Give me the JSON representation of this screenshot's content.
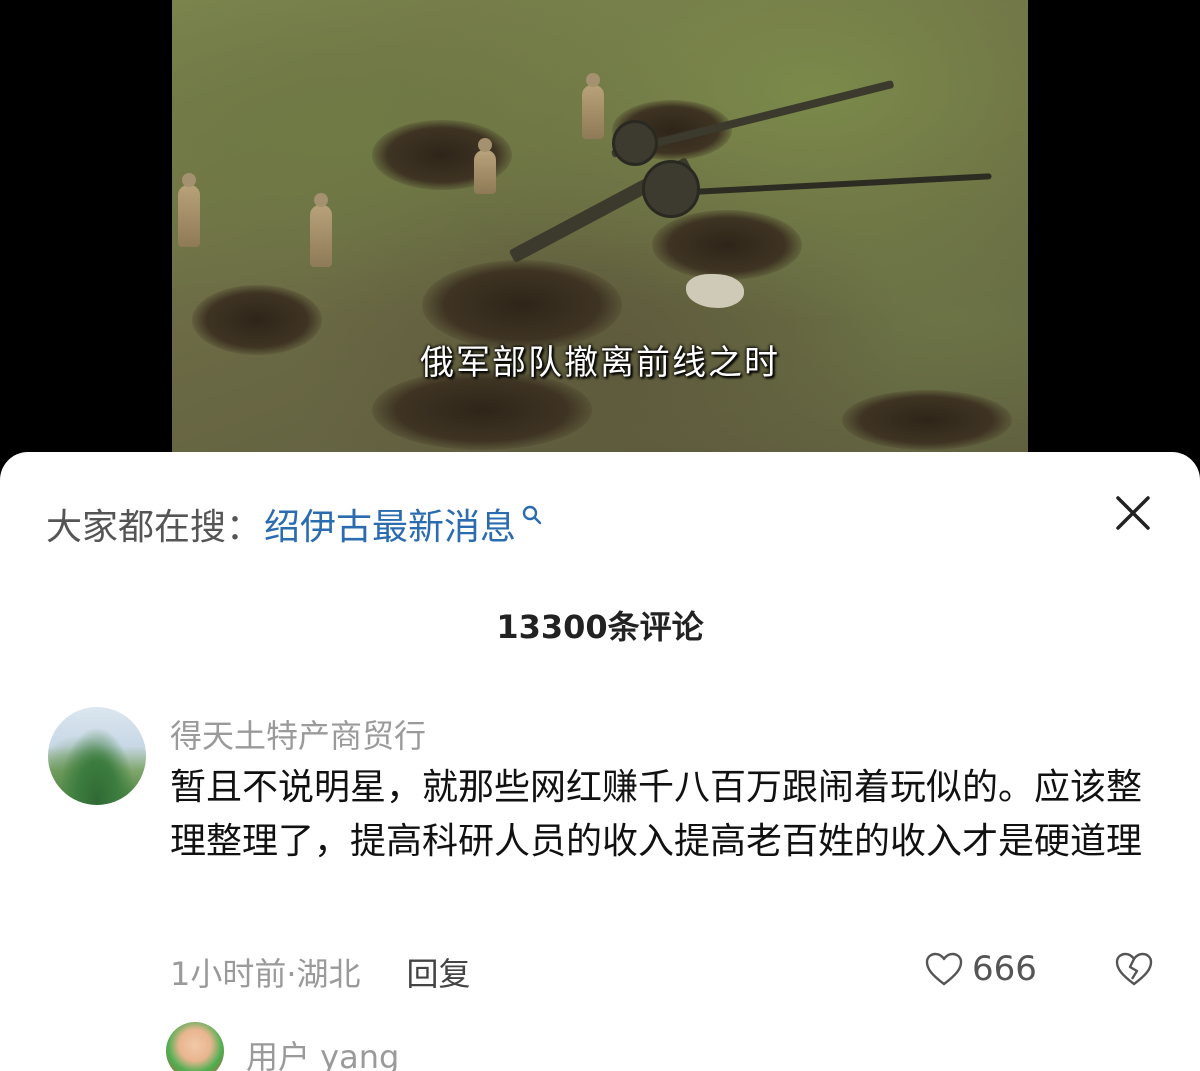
{
  "video": {
    "subtitle": "俄军部队撤离前线之时"
  },
  "search": {
    "prefix": "大家都在搜：",
    "term": "绍伊古最新消息"
  },
  "comments": {
    "count_label": "13300条评论",
    "items": [
      {
        "username": "得天土特产商贸行",
        "text": "暂且不说明星，就那些网红赚千八百万跟闹着玩似的。应该整理整理了，提高科研人员的收入提高老百姓的收入才是硬道理",
        "time": "1小时前·湖北",
        "reply_label": "回复",
        "likes": "666"
      },
      {
        "username": "用户 yang"
      }
    ]
  },
  "colors": {
    "link": "#2b6cb0",
    "muted": "#9a9a9a"
  },
  "icons": [
    "search-icon",
    "close-icon",
    "heart-icon",
    "broken-heart-icon"
  ]
}
